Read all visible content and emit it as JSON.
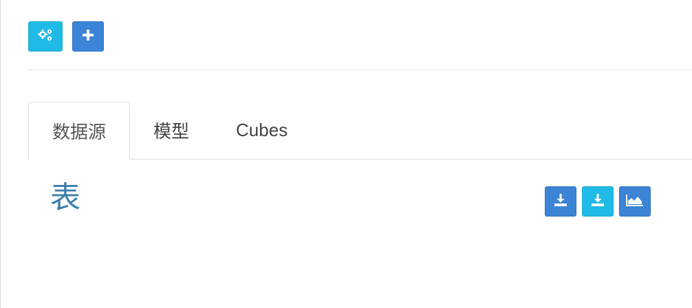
{
  "toolbar": {
    "buttons": [
      {
        "icon": "gears-icon",
        "color": "#1fbbe6"
      },
      {
        "icon": "plus-icon",
        "color": "#3b84d6"
      }
    ]
  },
  "tabs": [
    {
      "label": "数据源",
      "active": true
    },
    {
      "label": "模型",
      "active": false
    },
    {
      "label": "Cubes",
      "active": false
    }
  ],
  "section": {
    "title": "表",
    "title_color": "#3a7fa9",
    "actions": [
      {
        "icon": "download-icon",
        "color": "#3b84d6"
      },
      {
        "icon": "download-icon",
        "color": "#1fbbe6"
      },
      {
        "icon": "area-chart-icon",
        "color": "#3b84d6"
      }
    ]
  }
}
